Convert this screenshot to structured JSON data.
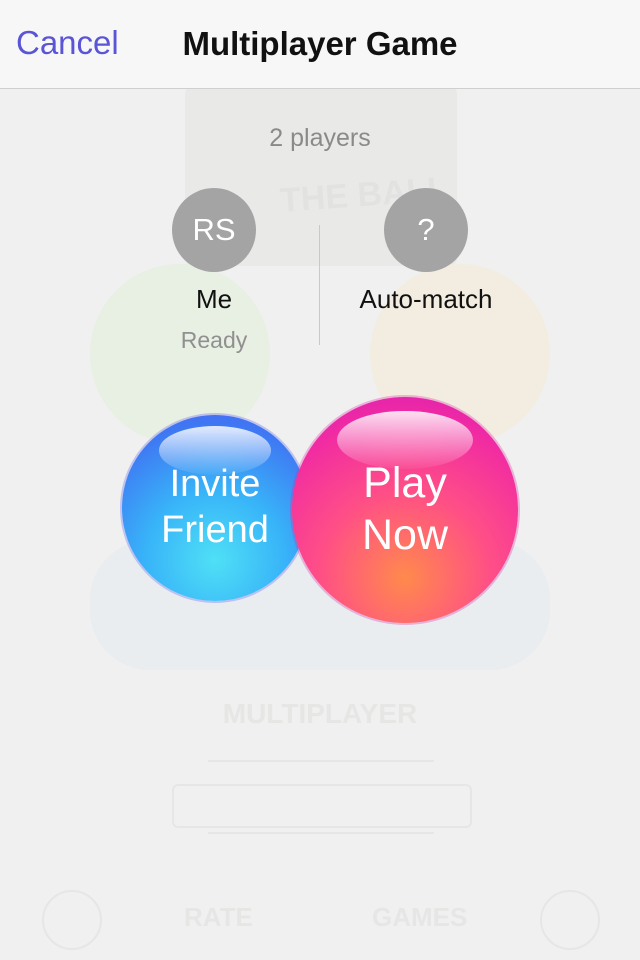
{
  "navbar": {
    "cancel_label": "Cancel",
    "title": "Multiplayer Game"
  },
  "players_count": "2 players",
  "players": [
    {
      "initials": "RS",
      "name": "Me",
      "status": "Ready"
    },
    {
      "initials": "?",
      "name": "Auto-match",
      "status": ""
    }
  ],
  "actions": {
    "invite_line1": "Invite",
    "invite_line2": "Friend",
    "play_line1": "Play",
    "play_line2": "Now"
  },
  "background": {
    "logo_text": "THE BALL",
    "mode_text": "MULTIPLAYER",
    "rate_text": "RATE",
    "games_text": "GAMES"
  },
  "colors": {
    "accent": "#5a55d6",
    "avatar": "#a4a4a4",
    "invite_bubble": "#38b4f8",
    "play_bubble": "#f12ba2",
    "background": "#eff0ef"
  }
}
